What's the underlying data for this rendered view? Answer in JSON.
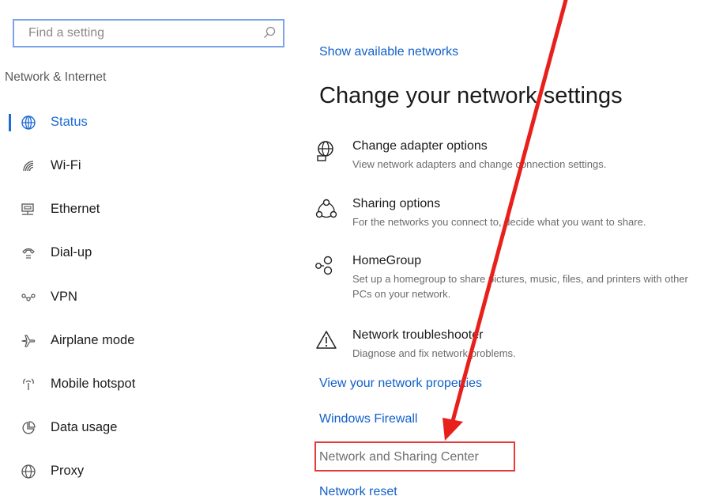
{
  "search": {
    "placeholder": "Find a setting"
  },
  "sidebar": {
    "section_title": "Network & Internet",
    "items": [
      {
        "label": "Status",
        "icon": "globe-icon",
        "active": true
      },
      {
        "label": "Wi-Fi",
        "icon": "wifi-icon"
      },
      {
        "label": "Ethernet",
        "icon": "ethernet-icon"
      },
      {
        "label": "Dial-up",
        "icon": "phone-icon"
      },
      {
        "label": "VPN",
        "icon": "vpn-icon"
      },
      {
        "label": "Airplane mode",
        "icon": "airplane-icon"
      },
      {
        "label": "Mobile hotspot",
        "icon": "hotspot-icon"
      },
      {
        "label": "Data usage",
        "icon": "pie-chart-icon"
      },
      {
        "label": "Proxy",
        "icon": "globe-icon"
      }
    ]
  },
  "main": {
    "show_networks_link": "Show available networks",
    "title": "Change your network settings",
    "options": [
      {
        "title": "Change adapter options",
        "desc": "View network adapters and change connection settings.",
        "icon": "adapter-icon"
      },
      {
        "title": "Sharing options",
        "desc": "For the networks you connect to, decide what you want to share.",
        "icon": "sharing-icon"
      },
      {
        "title": "HomeGroup",
        "desc": "Set up a homegroup to share pictures, music, files, and printers with other PCs on your network.",
        "icon": "homegroup-icon"
      },
      {
        "title": "Network troubleshooter",
        "desc": "Diagnose and fix network problems.",
        "icon": "warning-icon"
      }
    ],
    "links": {
      "view_properties": "View your network properties",
      "firewall": "Windows Firewall",
      "sharing_center": "Network and Sharing Center",
      "reset": "Network reset"
    }
  },
  "colors": {
    "accent": "#1d6bd6",
    "link": "#1160c9",
    "annotation": "#e8201c",
    "search_border": "#7aa3e8"
  }
}
